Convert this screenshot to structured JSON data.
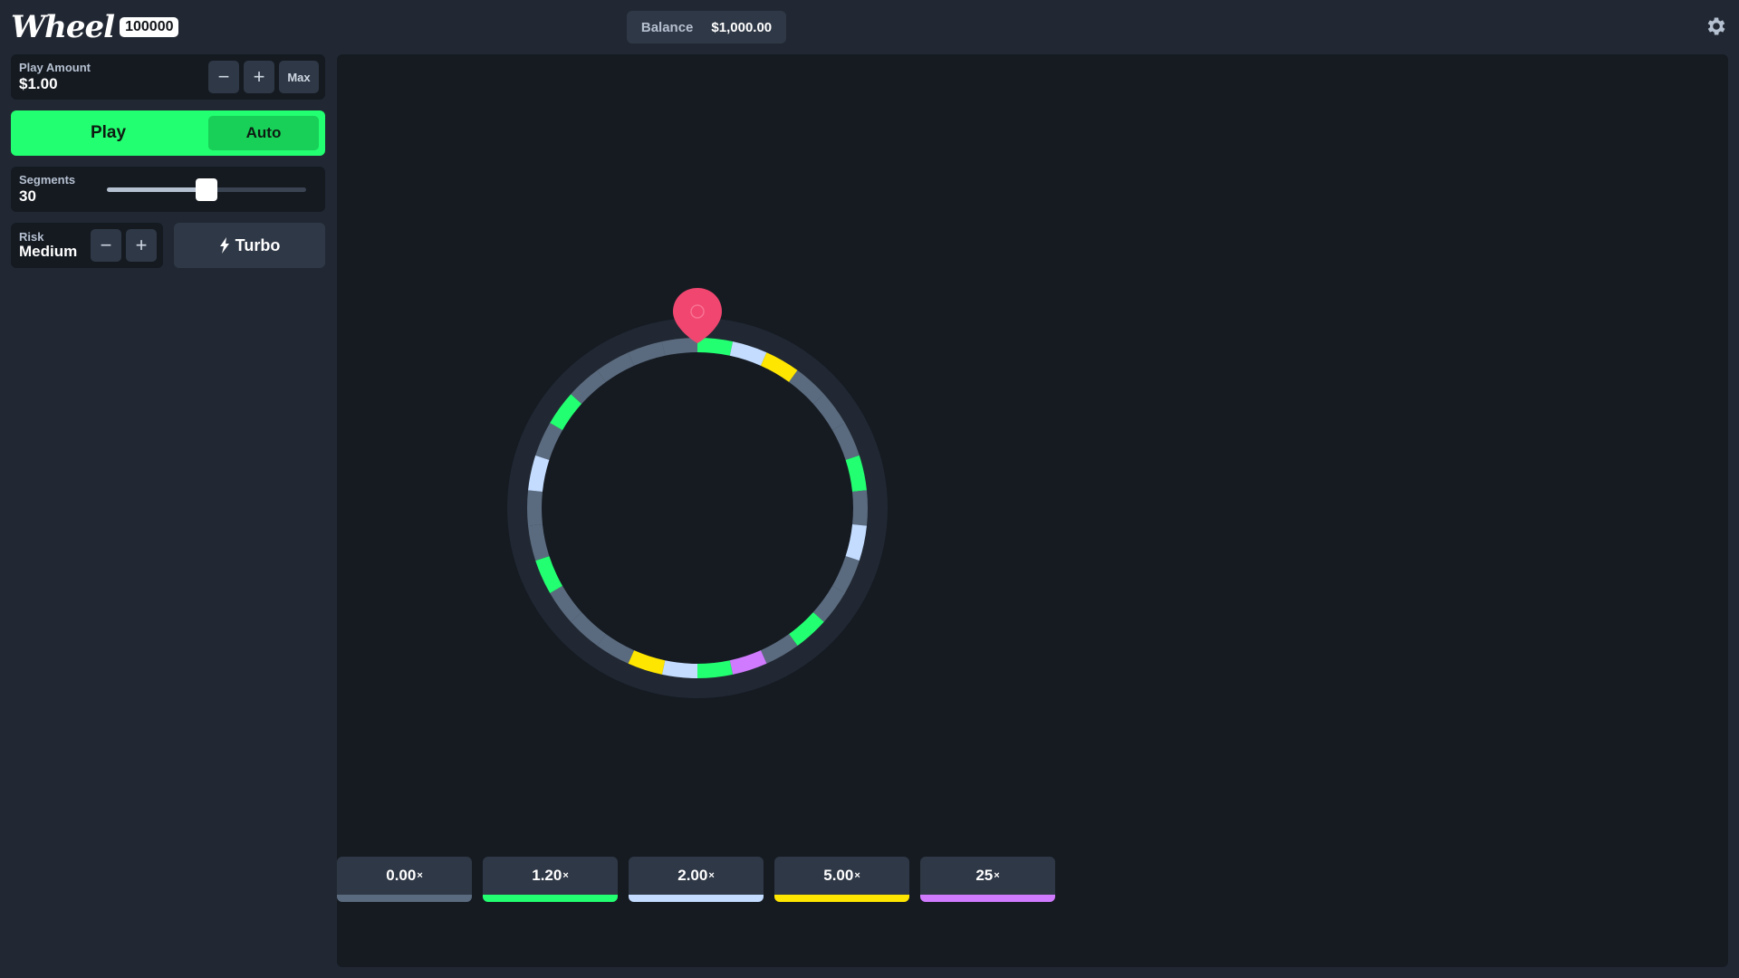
{
  "brand": {
    "name": "Wheel",
    "badge": "100000"
  },
  "balance": {
    "label": "Balance",
    "value": "$1,000.00"
  },
  "controls": {
    "play_amount": {
      "label": "Play Amount",
      "value": "$1.00",
      "max_label": "Max"
    },
    "play_label": "Play",
    "auto_label": "Auto",
    "segments": {
      "label": "Segments",
      "value": "30",
      "slider_fraction": 0.5
    },
    "risk": {
      "label": "Risk",
      "value": "Medium"
    },
    "turbo_label": "Turbo"
  },
  "colors": {
    "gray": "#5b6b7f",
    "green": "#22ff70",
    "lightblue": "#c3dcff",
    "yellow": "#ffe600",
    "purple": "#d07bff",
    "pointer": "#f04670"
  },
  "wheel": {
    "segments": [
      "green",
      "lightblue",
      "yellow",
      "gray",
      "gray",
      "gray",
      "green",
      "gray",
      "lightblue",
      "gray",
      "gray",
      "green",
      "gray",
      "purple",
      "green",
      "lightblue",
      "yellow",
      "gray",
      "gray",
      "gray",
      "green",
      "gray",
      "gray",
      "lightblue",
      "gray",
      "green",
      "gray",
      "gray",
      "gray",
      "gray"
    ]
  },
  "multipliers": [
    {
      "value": "0.00",
      "suffix": "×",
      "color": "gray"
    },
    {
      "value": "1.20",
      "suffix": "×",
      "color": "green"
    },
    {
      "value": "2.00",
      "suffix": "×",
      "color": "lightblue"
    },
    {
      "value": "5.00",
      "suffix": "×",
      "color": "yellow"
    },
    {
      "value": "25",
      "suffix": "×",
      "color": "purple"
    }
  ]
}
